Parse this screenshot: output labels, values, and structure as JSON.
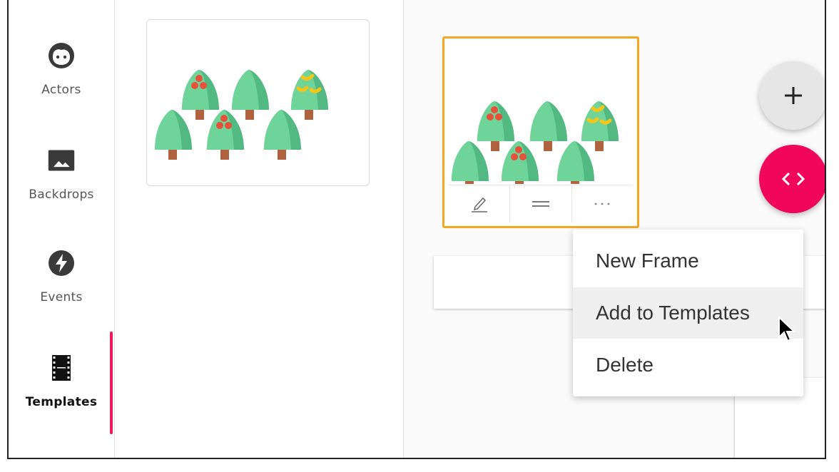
{
  "sidebar": {
    "items": [
      {
        "label": "Actors",
        "icon": "face-icon"
      },
      {
        "label": "Backdrops",
        "icon": "image-icon"
      },
      {
        "label": "Events",
        "icon": "bolt-icon"
      },
      {
        "label": "Templates",
        "icon": "film-icon",
        "active": true
      }
    ]
  },
  "frame_card": {
    "tools": [
      "edit-icon",
      "drag-handle-icon",
      "more-icon"
    ]
  },
  "fabs": {
    "add_icon": "plus-icon",
    "code_icon": "code-icon"
  },
  "context_menu": {
    "items": [
      "New Frame",
      "Add to Templates",
      "Delete"
    ],
    "hovered": "Add to Templates"
  },
  "colors": {
    "accent": "#f0175b",
    "selected_frame": "#f5a623",
    "fab_code": "#f0075c",
    "tree_light": "#6fd49a",
    "tree_dark": "#52b983",
    "trunk": "#b0623f"
  }
}
